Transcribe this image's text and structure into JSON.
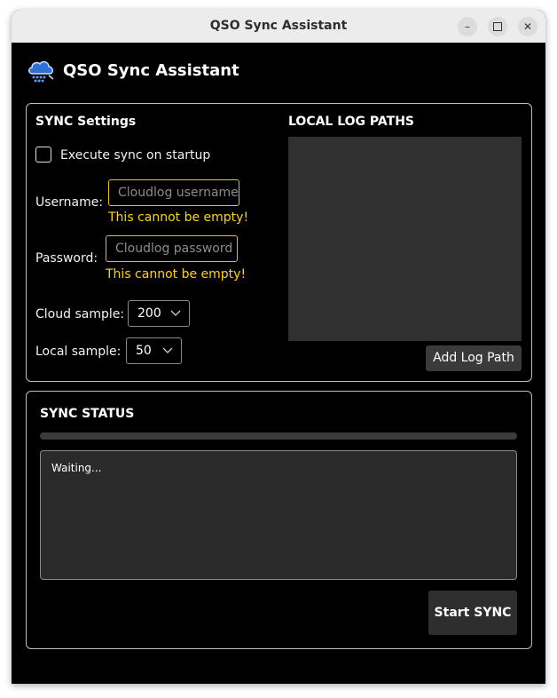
{
  "window": {
    "title": "QSO Sync Assistant",
    "buttons": {
      "minimize": "–",
      "close": "✕"
    }
  },
  "app": {
    "title": "QSO Sync Assistant",
    "logo_icon": "cloud-sync-icon"
  },
  "settings": {
    "title": "SYNC Settings",
    "startup_checkbox": {
      "label": "Execute sync on startup",
      "checked": false
    },
    "username": {
      "label": "Username:",
      "placeholder": "Cloudlog username",
      "value": "",
      "error": "This cannot be empty!"
    },
    "password": {
      "label": "Password:",
      "placeholder": "Cloudlog password",
      "value": "",
      "error": "This cannot be empty!"
    },
    "cloud_sample": {
      "label": "Cloud sample:",
      "value": "200"
    },
    "local_sample": {
      "label": "Local sample:",
      "value": "50"
    }
  },
  "log_paths": {
    "title": "LOCAL LOG PATHS",
    "items": [],
    "add_button": "Add Log Path"
  },
  "status": {
    "title": "SYNC STATUS",
    "progress": 0,
    "log": "Waiting...",
    "start_button": "Start SYNC"
  },
  "colors": {
    "background": "#000000",
    "error": "#ffd500",
    "input_border_error": "#e6c200",
    "panel_border": "#bdbdbd"
  }
}
